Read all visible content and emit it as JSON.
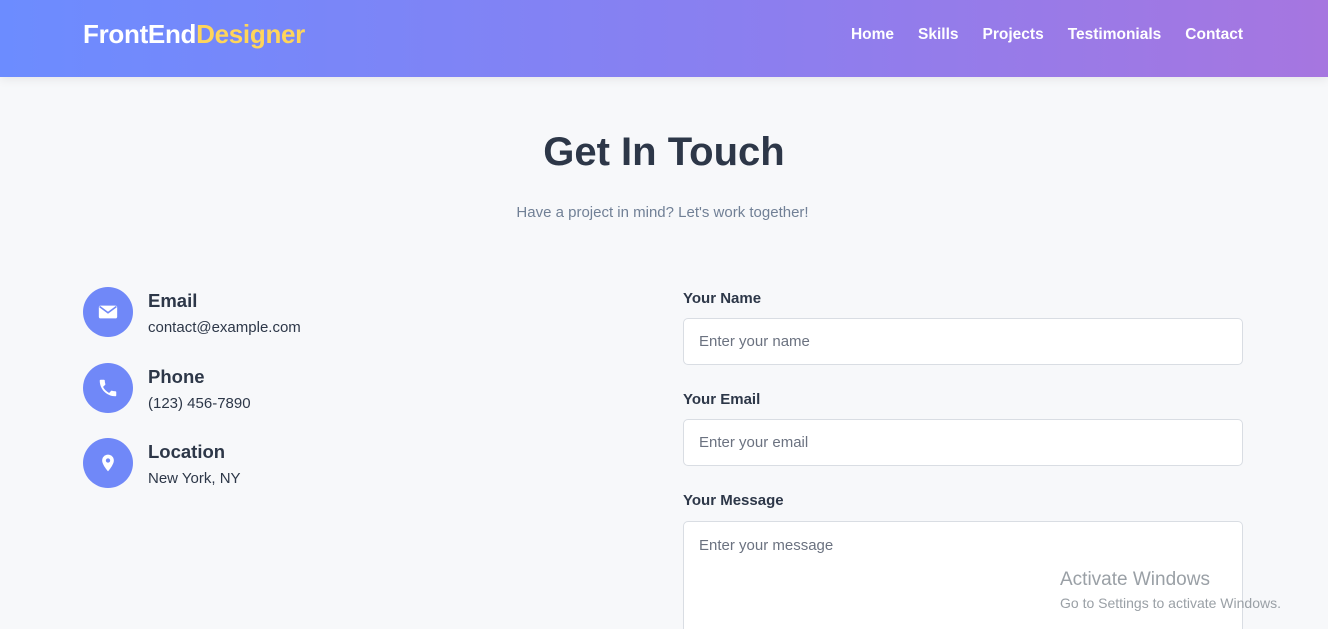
{
  "header": {
    "logo_part1": "FrontEnd",
    "logo_part2": "Designer",
    "nav": [
      {
        "label": "Home"
      },
      {
        "label": "Skills"
      },
      {
        "label": "Projects"
      },
      {
        "label": "Testimonials"
      },
      {
        "label": "Contact"
      }
    ]
  },
  "section": {
    "title": "Get In Touch",
    "subtitle": "Have a project in mind? Let's work together!"
  },
  "contact_info": [
    {
      "icon": "envelope-icon",
      "title": "Email",
      "value": "contact@example.com"
    },
    {
      "icon": "phone-icon",
      "title": "Phone",
      "value": "(123) 456-7890"
    },
    {
      "icon": "location-pin-icon",
      "title": "Location",
      "value": "New York, NY"
    }
  ],
  "form": {
    "name": {
      "label": "Your Name",
      "placeholder": "Enter your name",
      "value": ""
    },
    "email": {
      "label": "Your Email",
      "placeholder": "Enter your email",
      "value": ""
    },
    "message": {
      "label": "Your Message",
      "placeholder": "Enter your message",
      "value": ""
    }
  },
  "watermark": {
    "title": "Activate Windows",
    "subtitle": "Go to Settings to activate Windows."
  },
  "colors": {
    "header_gradient_start": "#6c8cff",
    "header_gradient_end": "#a676e0",
    "logo_accent": "#ffd55a",
    "icon_circle": "#7088f8",
    "page_background": "#f7f8fa",
    "text_dark": "#2d3748"
  }
}
